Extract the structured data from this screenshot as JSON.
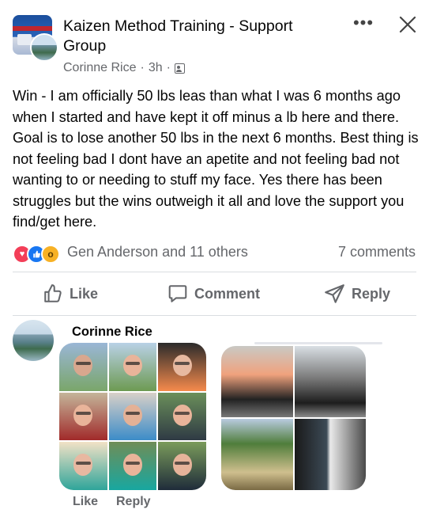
{
  "post": {
    "group_name": "Kaizen Method Training - Support Group",
    "author": "Corinne Rice",
    "time": "3h",
    "separator": "·",
    "body": "Win - I am officially 50 lbs leas than what I was 6 months ago when I started and have kept it off minus a lb here and there. Goal is to lose another 50 lbs in the next 6 months. Best thing is not feeling bad I dont have an apetite and not feeling bad not wanting to or needing to stuff my face. Yes there has been struggles but the wins outweigh it all and love the support you find/get here."
  },
  "header": {
    "more_icon": "more-horizontal-icon",
    "close_icon": "close-icon",
    "audience_icon": "group-audience-icon"
  },
  "reactions": {
    "types": [
      "love",
      "like",
      "wow"
    ],
    "summary": "Gen Anderson and 11 others",
    "comments": "7 comments"
  },
  "actions": {
    "like": "Like",
    "comment": "Comment",
    "reply": "Reply"
  },
  "comment": {
    "author": "Corinne Rice",
    "like": "Like",
    "reply": "Reply"
  },
  "colors": {
    "accent": "#1877f2",
    "love": "#f33e58",
    "wow": "#f7b125",
    "muted": "#65676b"
  }
}
